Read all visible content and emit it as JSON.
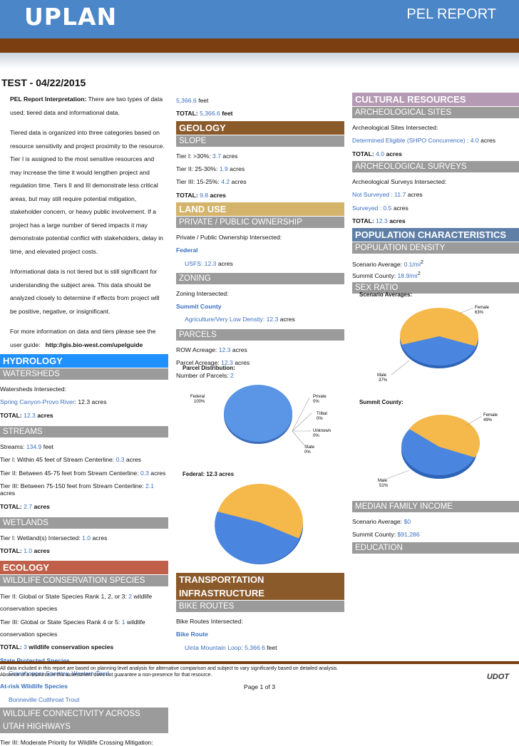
{
  "header": {
    "logo": "UPLAN",
    "report": "PEL REPORT",
    "title": "TEST - 04/22/2015"
  },
  "intro": {
    "p1_bold": "PEL Report Interpretation:",
    "p1": " There are two types of data used; tiered data and informational data.",
    "p2": "Tiered data is organized into three categories based on resource sensitivity and project proximity to the resource. Tier I is assigned to the most sensitive resources and may increase the time it would lengthen project and regulation time. Tiers II and III demonstrate less critical areas, but may still require potential mitigation, stakeholder concern, or heavy public involvement. If a project has a large number of tiered impacts it may demonstrate potential conflict with stakeholders, delay in time, and elevated project costs.",
    "p3": "Informational data is not tiered but is still significant for understanding the subject area. This data should be analyzed closely to determine if effects from project will be positive, negative, or insignificant.",
    "p4": "For more information on data and tiers please see the user guide:",
    "guide_url": "http://gis.bio-west.com/upelguide"
  },
  "hydrology": {
    "title": "HYDROLOGY",
    "watersheds": {
      "title": "WATERSHEDS",
      "label": "Watersheds Intersected:",
      "item": "Spring Canyon-Provo River",
      "item_val": ": 12.3 acres",
      "total_label": "TOTAL:",
      "total_val": "12.3",
      "total_unit": "acres"
    },
    "streams": {
      "title": "STREAMS",
      "label": "Streams:",
      "val": "134.9",
      "unit": "feet",
      "t1": "Tier I: Within 45 feet of Stream Centerline:",
      "t1v": "0.3",
      "t2": "Tier II: Between 45-75 feet from Stream Centerline:",
      "t2v": "0.3",
      "t3": "Tier III: Between 75-150 feet from Stream Centerline:",
      "t3v": "2.1",
      "unit2": "acres",
      "total_label": "TOTAL:",
      "total_val": "2.7",
      "total_unit": "acres"
    },
    "wetlands": {
      "title": "WETLANDS",
      "t1": "Tier I: Wetland(s) Intersected:",
      "t1v": "1.0",
      "unit": "acres",
      "total_label": "TOTAL:",
      "total_val": "1.0",
      "total_unit": "acres"
    }
  },
  "ecology": {
    "title": "ECOLOGY",
    "wcs": {
      "title": "WILDLIFE CONSERVATION SPECIES",
      "t2": "Tier II: Global or State Species Rank 1, 2, or 3:",
      "t2v": "2",
      "t2u": "wildlife conservation species",
      "t3": "Tier III: Global or State Species Rank 4 or 5:",
      "t3v": "1",
      "t3u": "wildlife conservation species",
      "total_label": "TOTAL:",
      "total_val": "3",
      "total_unit": "wildlife conservation species",
      "sps": "State Protected Species",
      "sps_items": "Grasshopper Sparrow, Western Toad",
      "ars": "At-risk Wildlife Species",
      "ars_items": "Bonneville Cutthroat Trout"
    },
    "conn": {
      "title1": "WILDLIFE CONNECTIVITY ACROSS",
      "title2": "UTAH HIGHWAYS",
      "t3": "Tier III: Moderate Priority for Wildlife Crossing Mitigation:"
    }
  },
  "col2": {
    "cont_val": "5,366.6",
    "cont_unit": "feet",
    "cont_total_label": "TOTAL:",
    "cont_total_val": "5,366.6",
    "cont_total_unit": "feet",
    "geology": {
      "title": "GEOLOGY",
      "slope": "SLOPE",
      "t1": "Tier I: >30%:",
      "t1v": "3.7",
      "t2": "Tier II: 25-30%:",
      "t2v": "1.9",
      "t3": "Tier III: 15-25%:",
      "t3v": "4.2",
      "unit": "acres",
      "total_label": "TOTAL:",
      "total_val": "9.8",
      "total_unit": "acres"
    },
    "landuse": {
      "title": "LAND USE",
      "own": "PRIVATE / PUBLIC OWNERSHIP",
      "own_label": "Private / Public Ownership Intersected:",
      "fed": "Federal",
      "usfs": "USFS:",
      "usfs_v": "12.3",
      "unit": "acres",
      "zoning": "ZONING",
      "z_label": "Zoning Intersected:",
      "z_county": "Summit County",
      "z_item": "Agriculture/Very Low Density:",
      "z_v": "12.3",
      "parcels": "PARCELS",
      "row": "ROW Acreage:",
      "row_v": "12.3",
      "pa": "Parcel Acreage:",
      "pa_v": "12.3",
      "np": "Number of Parcels:",
      "np_v": "2",
      "dist": "Parcel Distribution:",
      "fed_chart": "Federal: 12.3 acres"
    },
    "transport": {
      "title1": "TRANSPORTATION",
      "title2": "INFRASTRUCTURE",
      "bike": "BIKE ROUTES",
      "b_label": "Bike Routes Intersected:",
      "b_head": "Bike Route",
      "b_item": "Uinta Mountain Loop:",
      "b_v": "5,366.6",
      "b_u": "feet"
    }
  },
  "col3": {
    "cultural": {
      "title": "CULTURAL RESOURCES",
      "arch": "ARCHEOLOGICAL SITES",
      "a_label": "Archeological Sites Intersected:",
      "a_item": "Determined Eligible (SHPO Concurrence) : 4.0",
      "a_u": "acres",
      "a_total_label": "TOTAL:",
      "a_total_val": "4.0",
      "a_total_unit": "acres",
      "surv": "ARCHEOLOGICAL SURVEYS",
      "s_label": "Archeological Surveys Intersected:",
      "s1": "Not Surveyed : 11.7",
      "s2": "Surveyed : 0.5",
      "s_u": "acres",
      "s_total_label": "TOTAL:",
      "s_total_val": "12.3",
      "s_total_unit": "acres"
    },
    "pop": {
      "title": "POPULATION CHARACTERISTICS",
      "dens": "POPULATION DENSITY",
      "sa": "Scenario Average:",
      "sa_v": "0.1/mi",
      "sc": "Summit County:",
      "sc_v": "18.9/mi",
      "sup": "2",
      "sex": "SEX RATIO",
      "sex_sa": "Scenario Averages:",
      "sex_sc": "Summit County:",
      "mfi": "MEDIAN FAMILY INCOME",
      "m_sa": "Scenario Average:",
      "m_sa_v": "$0",
      "m_sc": "Summit County:",
      "m_sc_v": "$91,286",
      "edu": "EDUCATION"
    }
  },
  "footer": {
    "l1": "All data included in this report are based on planning level analysis for alternative comparison and subject to vary significantly based on detailed analysis.",
    "l2": "Absence of a resource in this assessment does not guarantee a non-presence for that resource.",
    "logo": "UDOT",
    "page": "Page 1 of 3"
  },
  "chart_data": [
    {
      "type": "pie",
      "title": "Parcel Distribution:",
      "labels": [
        "Federal",
        "Private",
        "Tribal",
        "Unknown",
        "State"
      ],
      "values": [
        100,
        0,
        0,
        0,
        0
      ]
    },
    {
      "type": "pie",
      "title": "Federal: 12.3 acres",
      "labels": [
        "",
        ""
      ],
      "values": [
        55,
        45
      ],
      "colors": [
        "#f5b84a",
        "#4a86e0"
      ]
    },
    {
      "type": "pie",
      "title": "Scenario Averages:",
      "labels": [
        "Female",
        "Male"
      ],
      "values": [
        63,
        37
      ]
    },
    {
      "type": "pie",
      "title": "Summit County:",
      "labels": [
        "Female",
        "Male"
      ],
      "values": [
        49,
        51
      ]
    }
  ],
  "colors": {
    "orange": "#f5b84a",
    "blue": "#4a86e0",
    "link": "#3a6fc0"
  }
}
